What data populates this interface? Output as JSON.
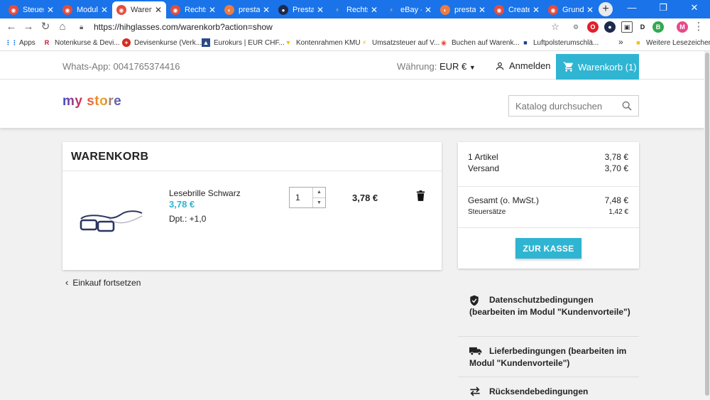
{
  "tabs": [
    {
      "label": "Steuer",
      "active": false
    },
    {
      "label": "Module",
      "active": false
    },
    {
      "label": "Warenk",
      "active": true
    },
    {
      "label": "Rechtsi",
      "active": false
    },
    {
      "label": "prestas",
      "active": false
    },
    {
      "label": "PrestaS",
      "active": false
    },
    {
      "label": "Rechtsi",
      "active": false
    },
    {
      "label": "eBay -",
      "active": false
    },
    {
      "label": "prestas",
      "active": false
    },
    {
      "label": "Create",
      "active": false
    },
    {
      "label": "Grundp",
      "active": false
    }
  ],
  "address_bar": {
    "url": "https://hihglasses.com/warenkorb?action=show"
  },
  "bookmarks": [
    {
      "label": "Apps"
    },
    {
      "label": "Notenkurse & Devi..."
    },
    {
      "label": "Devisenkurse (Verk..."
    },
    {
      "label": "Eurokurs | EUR CHF..."
    },
    {
      "label": "Kontenrahmen KMU"
    },
    {
      "label": "Umsatzsteuer auf V..."
    },
    {
      "label": "Buchen auf Warenk..."
    },
    {
      "label": "Luftpolsterumschlä..."
    }
  ],
  "bookmarks_other": "Weitere Lesezeichen",
  "bookmarks_more": "»",
  "colors": {
    "accent": "#2fb5d2",
    "chrome_blue": "#1a73e8"
  },
  "header": {
    "whatsapp": "Whats-App: 0041765374416",
    "currency_label": "Währung:",
    "currency_value": "EUR €",
    "login": "Anmelden",
    "cart": "Warenkorb (1)"
  },
  "brand": {
    "logo": "my store",
    "search_placeholder": "Katalog durchsuchen"
  },
  "cart": {
    "title": "WARENKORB",
    "items": [
      {
        "name": "Lesebrille Schwarz",
        "price": "3,78 €",
        "attribute": "Dpt.: +1,0",
        "quantity": "1",
        "line_total": "3,78 €"
      }
    ],
    "continue_label": "Einkauf fortsetzen"
  },
  "summary": {
    "items_label": "1 Artikel",
    "items_value": "3,78 €",
    "shipping_label": "Versand",
    "shipping_value": "3,70 €",
    "total_label": "Gesamt (o. MwSt.)",
    "total_value": "7,48 €",
    "tax_label": "Steuersätze",
    "tax_value": "1,42 €",
    "checkout": "ZUR KASSE"
  },
  "reassurance": [
    {
      "icon": "shield-icon",
      "line1": "Datenschutzbedingungen",
      "rest": "(bearbeiten im Modul \"Kundenvorteile\")"
    },
    {
      "icon": "truck-icon",
      "line1": "Lieferbedingungen (bearbeiten im",
      "rest": "Modul \"Kundenvorteile\")"
    },
    {
      "icon": "swap-arrows-icon",
      "line1": "Rücksendebedingungen",
      "rest": ""
    }
  ]
}
